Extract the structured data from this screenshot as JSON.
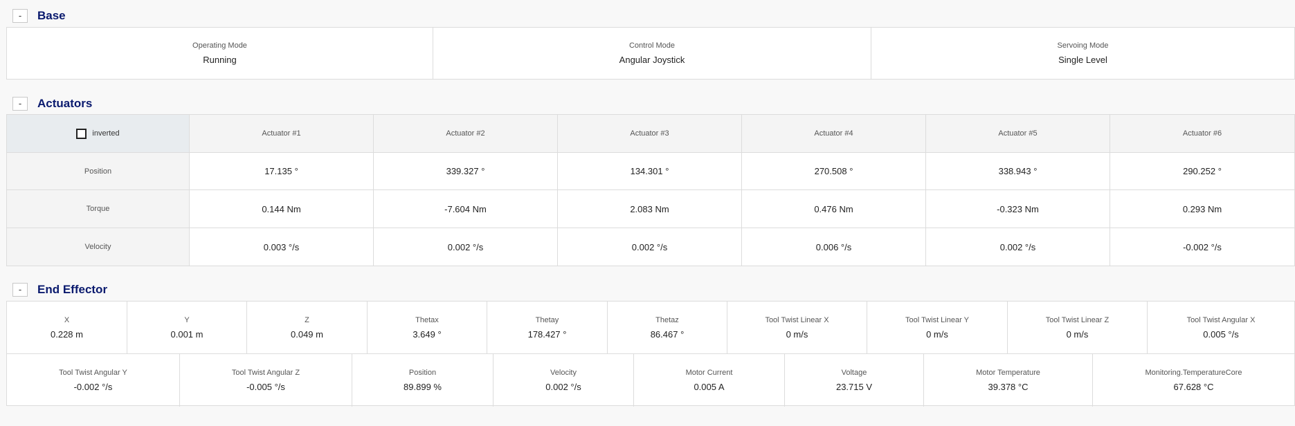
{
  "base": {
    "title": "Base",
    "collapse_label": "-",
    "cells": [
      {
        "label": "Operating Mode",
        "value": "Running"
      },
      {
        "label": "Control Mode",
        "value": "Angular Joystick"
      },
      {
        "label": "Servoing Mode",
        "value": "Single Level"
      }
    ]
  },
  "actuators": {
    "title": "Actuators",
    "collapse_label": "-",
    "inverted_label": "inverted",
    "inverted_checked": false,
    "columns": [
      "Actuator #1",
      "Actuator #2",
      "Actuator #3",
      "Actuator #4",
      "Actuator #5",
      "Actuator #6"
    ],
    "rows": [
      {
        "label": "Position",
        "values": [
          "17.135 °",
          "339.327 °",
          "134.301 °",
          "270.508 °",
          "338.943 °",
          "290.252 °"
        ]
      },
      {
        "label": "Torque",
        "values": [
          "0.144 Nm",
          "-7.604 Nm",
          "2.083 Nm",
          "0.476 Nm",
          "-0.323 Nm",
          "0.293 Nm"
        ]
      },
      {
        "label": "Velocity",
        "values": [
          "0.003 °/s",
          "0.002 °/s",
          "0.002 °/s",
          "0.006 °/s",
          "0.002 °/s",
          "-0.002 °/s"
        ]
      }
    ]
  },
  "end_effector": {
    "title": "End Effector",
    "collapse_label": "-",
    "row1": [
      {
        "label": "X",
        "value": "0.228 m"
      },
      {
        "label": "Y",
        "value": "0.001 m"
      },
      {
        "label": "Z",
        "value": "0.049 m"
      },
      {
        "label": "Thetax",
        "value": "3.649 °"
      },
      {
        "label": "Thetay",
        "value": "178.427 °"
      },
      {
        "label": "Thetaz",
        "value": "86.467 °"
      },
      {
        "label": "Tool Twist Linear X",
        "value": "0 m/s"
      },
      {
        "label": "Tool Twist Linear Y",
        "value": "0 m/s"
      },
      {
        "label": "Tool Twist Linear Z",
        "value": "0 m/s"
      },
      {
        "label": "Tool Twist Angular X",
        "value": "0.005 °/s"
      }
    ],
    "row2": [
      {
        "label": "Tool Twist Angular Y",
        "value": "-0.002 °/s"
      },
      {
        "label": "Tool Twist Angular Z",
        "value": "-0.005 °/s"
      },
      {
        "label": "Position",
        "value": "89.899 %"
      },
      {
        "label": "Velocity",
        "value": "0.002 °/s"
      },
      {
        "label": "Motor Current",
        "value": "0.005 A"
      },
      {
        "label": "Voltage",
        "value": "23.715 V"
      },
      {
        "label": "Motor Temperature",
        "value": "39.378 °C"
      },
      {
        "label": "Monitoring.TemperatureCore",
        "value": "67.628 °C"
      }
    ]
  }
}
